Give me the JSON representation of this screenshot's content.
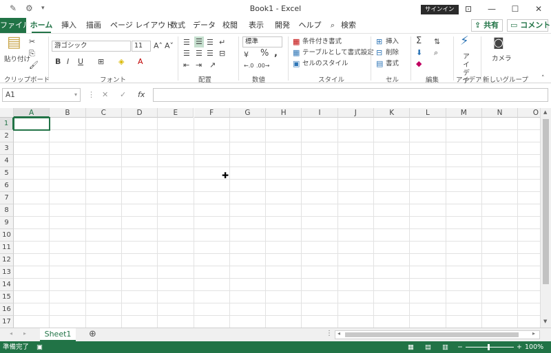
{
  "title": "Book1  -  Excel",
  "signin_label": "サインイン",
  "tabs": [
    "ファイル",
    "ホーム",
    "挿入",
    "描画",
    "ページ レイアウト",
    "数式",
    "データ",
    "校閲",
    "表示",
    "開発",
    "ヘルプ",
    "検索"
  ],
  "share_label": "共有",
  "comment_label": "コメント",
  "clipboard": {
    "paste": "貼り付け",
    "group": "クリップボード"
  },
  "font": {
    "name": "游ゴシック",
    "size": "11",
    "group": "フォント"
  },
  "alignment": {
    "group": "配置"
  },
  "number": {
    "format": "標準",
    "group": "数値"
  },
  "styles": {
    "conditional": "条件付き書式",
    "table": "テーブルとして書式設定",
    "cell_styles": "セルのスタイル",
    "group": "スタイル"
  },
  "cells": {
    "insert": "挿入",
    "delete": "削除",
    "format": "書式",
    "group": "セル"
  },
  "editing": {
    "group": "編集"
  },
  "ideas": {
    "label": "アイデア",
    "group": "アイデア"
  },
  "newgroup": {
    "camera": "カメラ",
    "group": "新しいグループ"
  },
  "namebox": "A1",
  "fx": "fx",
  "columns": [
    "A",
    "B",
    "C",
    "D",
    "E",
    "F",
    "G",
    "H",
    "I",
    "J",
    "K",
    "L",
    "M",
    "N",
    "O"
  ],
  "rows": [
    "1",
    "2",
    "3",
    "4",
    "5",
    "6",
    "7",
    "8",
    "9",
    "10",
    "11",
    "12",
    "13",
    "14",
    "15",
    "16",
    "17"
  ],
  "sheet_name": "Sheet1",
  "status_text": "準備完了",
  "zoom": "100%",
  "colors": {
    "accent": "#217346"
  }
}
